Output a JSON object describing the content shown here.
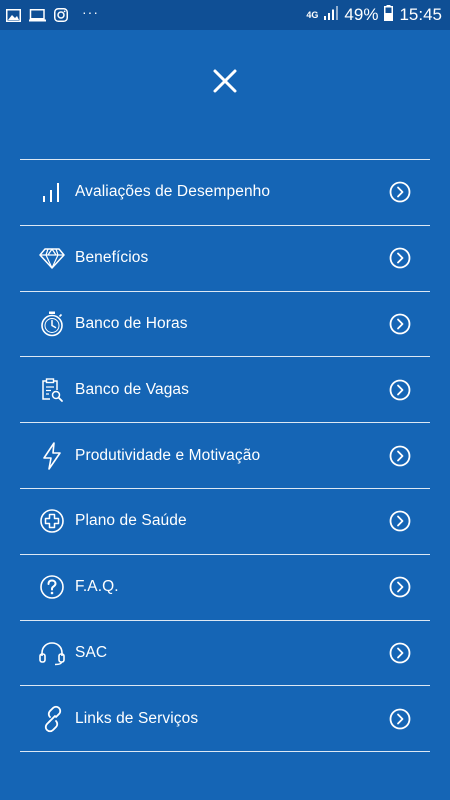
{
  "status_bar": {
    "left_icons": [
      "gallery-icon",
      "cast-icon",
      "instagram-icon"
    ],
    "more": "···",
    "network": "4G",
    "battery": "49%",
    "time": "15:45"
  },
  "header": {
    "close_icon": "close-icon"
  },
  "menu": {
    "items": [
      {
        "label": "Avaliações de Desempenho",
        "icon": "bar-chart-icon"
      },
      {
        "label": "Benefícios",
        "icon": "diamond-icon"
      },
      {
        "label": "Banco de Horas",
        "icon": "stopwatch-icon"
      },
      {
        "label": "Banco de Vagas",
        "icon": "clipboard-search-icon"
      },
      {
        "label": "Produtividade e Motivação",
        "icon": "lightning-icon"
      },
      {
        "label": "Plano de Saúde",
        "icon": "medical-cross-icon"
      },
      {
        "label": "F.A.Q.",
        "icon": "question-icon"
      },
      {
        "label": "SAC",
        "icon": "headset-icon"
      },
      {
        "label": "Links de Serviços",
        "icon": "link-icon"
      }
    ]
  },
  "colors": {
    "background": "#1565b5",
    "status_bar": "#0f4f95",
    "foreground": "#ffffff"
  }
}
